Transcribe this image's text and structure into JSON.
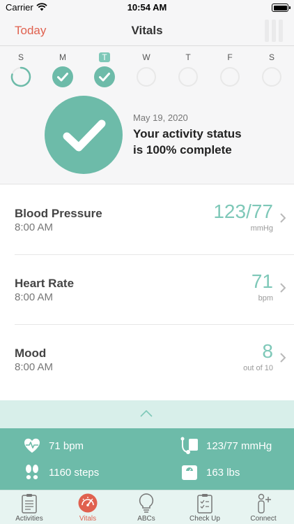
{
  "status_bar": {
    "carrier": "Carrier",
    "time": "10:54 AM"
  },
  "nav": {
    "left_label": "Today",
    "title": "Vitals"
  },
  "week": {
    "days": [
      {
        "letter": "S",
        "state": "partial",
        "is_today": false
      },
      {
        "letter": "M",
        "state": "complete",
        "is_today": false
      },
      {
        "letter": "T",
        "state": "complete",
        "is_today": true
      },
      {
        "letter": "W",
        "state": "empty",
        "is_today": false
      },
      {
        "letter": "T",
        "state": "empty",
        "is_today": false
      },
      {
        "letter": "F",
        "state": "empty",
        "is_today": false
      },
      {
        "letter": "S",
        "state": "empty",
        "is_today": false
      }
    ]
  },
  "summary": {
    "date": "May 19, 2020",
    "line1": "Your activity status",
    "line2": "is 100% complete",
    "progress_percent": 100
  },
  "vitals": [
    {
      "title": "Blood Pressure",
      "time": "8:00 AM",
      "value": "123/77",
      "unit": "mmHg"
    },
    {
      "title": "Heart Rate",
      "time": "8:00 AM",
      "value": "71",
      "unit": "bpm"
    },
    {
      "title": "Mood",
      "time": "8:00 AM",
      "value": "8",
      "unit": "out of 10"
    }
  ],
  "stats": {
    "heart_rate": {
      "text": "71 bpm",
      "icon": "heart-pulse-icon"
    },
    "blood_pressure": {
      "text": "123/77 mmHg",
      "icon": "blood-pressure-cuff-icon"
    },
    "steps": {
      "text": "1160 steps",
      "icon": "footsteps-icon"
    },
    "weight": {
      "text": "163 lbs",
      "icon": "scale-icon"
    }
  },
  "tabs": [
    {
      "label": "Activities",
      "icon": "clipboard-list-icon",
      "active": false
    },
    {
      "label": "Vitals",
      "icon": "gauge-icon",
      "active": true
    },
    {
      "label": "ABCs",
      "icon": "lightbulb-icon",
      "active": false
    },
    {
      "label": "Check Up",
      "icon": "checklist-icon",
      "active": false
    },
    {
      "label": "Connect",
      "icon": "add-person-icon",
      "active": false
    }
  ],
  "colors": {
    "accent": "#e0614f",
    "teal": "#6dbba9",
    "teal_light": "#7ec8b8",
    "panel_light": "#d8efea",
    "ring_empty": "#e8e8e8"
  }
}
